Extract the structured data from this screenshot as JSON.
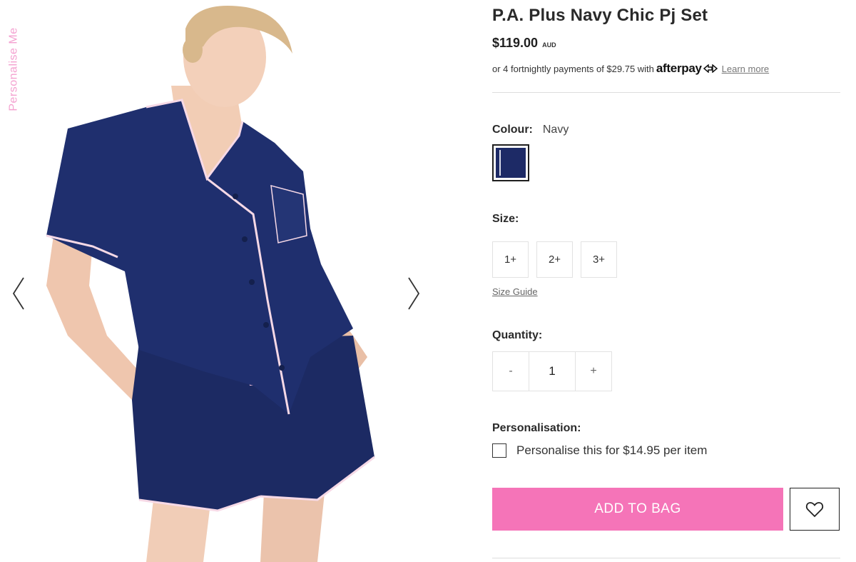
{
  "gallery": {
    "personalise_tab": "Personalise Me",
    "prev_icon": "chevron-left-icon",
    "next_icon": "chevron-right-icon",
    "image_subject": "model-navy-pj-set"
  },
  "product": {
    "title": "P.A. Plus Navy Chic Pj Set",
    "price": "$119.00",
    "currency": "AUD",
    "afterpay": {
      "text": "or 4 fortnightly payments of $29.75 with",
      "brand": "afterpay",
      "learn_more": "Learn more"
    },
    "colour": {
      "label": "Colour:",
      "value": "Navy",
      "swatch_color": "#1d2a66"
    },
    "size": {
      "label": "Size:",
      "options": [
        "1+",
        "2+",
        "3+"
      ],
      "guide": "Size Guide"
    },
    "quantity": {
      "label": "Quantity:",
      "minus": "-",
      "value": "1",
      "plus": "+"
    },
    "personalisation": {
      "label": "Personalisation:",
      "option": "Personalise this for $14.95 per item"
    },
    "add_to_bag": "ADD TO BAG",
    "wishlist_icon": "heart-icon"
  },
  "colors": {
    "accent_pink": "#f574b8",
    "tab_pink": "#f4a1d0",
    "navy": "#1d2a66"
  }
}
